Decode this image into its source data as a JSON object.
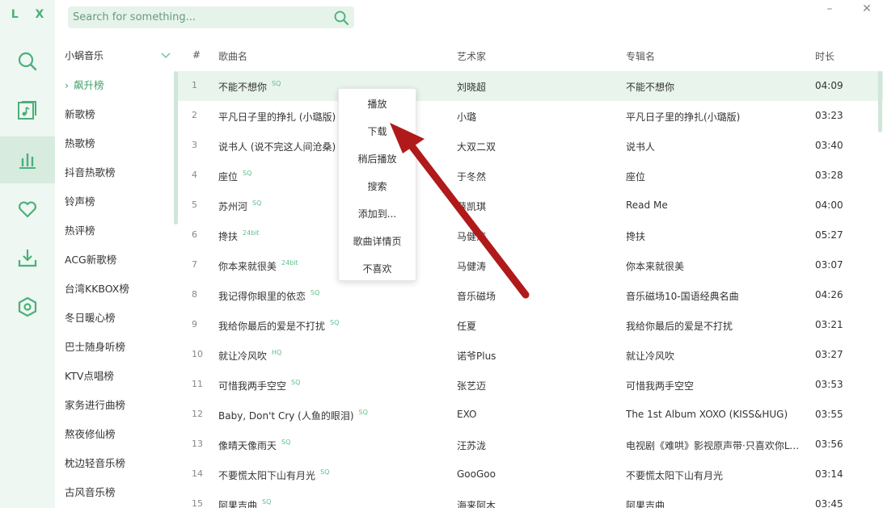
{
  "brand": "L X",
  "search": {
    "placeholder": "Search for something..."
  },
  "window": {
    "minimize": "–",
    "close": "✕"
  },
  "sidebar": [
    {
      "icon": "search-icon"
    },
    {
      "icon": "music-list-icon"
    },
    {
      "icon": "leaderboard-icon",
      "active": true
    },
    {
      "icon": "heart-icon"
    },
    {
      "icon": "download-icon"
    },
    {
      "icon": "settings-icon"
    }
  ],
  "source": {
    "selected": "小蜗音乐"
  },
  "boards": [
    "飙升榜",
    "新歌榜",
    "热歌榜",
    "抖音热歌榜",
    "铃声榜",
    "热评榜",
    "ACG新歌榜",
    "台湾KKBOX榜",
    "冬日暖心榜",
    "巴士随身听榜",
    "KTV点唱榜",
    "家务进行曲榜",
    "熬夜修仙榜",
    "枕边轻音乐榜",
    "古风音乐榜"
  ],
  "table": {
    "headers": {
      "num": "#",
      "name": "歌曲名",
      "artist": "艺术家",
      "album": "专辑名",
      "duration": "时长"
    },
    "rows": [
      {
        "num": "1",
        "name": "不能不想你",
        "quality": "SQ",
        "artist": "刘晓超",
        "album": "不能不想你",
        "duration": "04:09"
      },
      {
        "num": "2",
        "name": "平凡日子里的挣扎 (小璐版)",
        "quality": "",
        "artist": "小璐",
        "album": "平凡日子里的挣扎(小璐版)",
        "duration": "03:23"
      },
      {
        "num": "3",
        "name": "说书人 (说不完这人间沧桑)",
        "quality": "",
        "artist": "大双二双",
        "album": "说书人",
        "duration": "03:40"
      },
      {
        "num": "4",
        "name": "座位",
        "quality": "SQ",
        "artist": "于冬然",
        "album": "座位",
        "duration": "03:28"
      },
      {
        "num": "5",
        "name": "苏州河",
        "quality": "SQ",
        "artist": "薛凯琪",
        "album": "Read Me",
        "duration": "04:00"
      },
      {
        "num": "6",
        "name": "搀扶",
        "quality": "24bit",
        "artist": "马健涛",
        "album": "搀扶",
        "duration": "05:27"
      },
      {
        "num": "7",
        "name": "你本来就很美",
        "quality": "24bit",
        "artist": "马健涛",
        "album": "你本来就很美",
        "duration": "03:07"
      },
      {
        "num": "8",
        "name": "我记得你眼里的依恋",
        "quality": "SQ",
        "artist": "音乐磁场",
        "album": "音乐磁场10-国语经典名曲",
        "duration": "04:26"
      },
      {
        "num": "9",
        "name": "我给你最后的爱是不打扰",
        "quality": "SQ",
        "artist": "任夏",
        "album": "我给你最后的爱是不打扰",
        "duration": "03:21"
      },
      {
        "num": "10",
        "name": "就让冷风吹",
        "quality": "HQ",
        "artist": "诺爷Plus",
        "album": "就让冷风吹",
        "duration": "03:27"
      },
      {
        "num": "11",
        "name": "可惜我两手空空",
        "quality": "SQ",
        "artist": "张艺迈",
        "album": "可惜我两手空空",
        "duration": "03:53"
      },
      {
        "num": "12",
        "name": "Baby, Don't Cry (人鱼的眼泪)",
        "quality": "SQ",
        "artist": "EXO",
        "album": "The 1st Album XOXO (KISS&HUG)",
        "duration": "03:55"
      },
      {
        "num": "13",
        "name": "像晴天像雨天",
        "quality": "SQ",
        "artist": "汪苏泷",
        "album": "电视剧《难哄》影视原声带·只喜欢你Lo...",
        "duration": "03:56"
      },
      {
        "num": "14",
        "name": "不要慌太阳下山有月光",
        "quality": "SQ",
        "artist": "GooGoo",
        "album": "不要慌太阳下山有月光",
        "duration": "03:14"
      },
      {
        "num": "15",
        "name": "阿果吉曲",
        "quality": "SQ",
        "artist": "海来阿木",
        "album": "阿果吉曲",
        "duration": "03:45"
      }
    ]
  },
  "context_menu": [
    "播放",
    "下载",
    "稍后播放",
    "搜索",
    "添加到...",
    "歌曲详情页",
    "不喜欢"
  ],
  "colors": {
    "accent": "#4caf7a",
    "rail_bg": "#eef7f1",
    "arrow": "#b01a1a"
  }
}
